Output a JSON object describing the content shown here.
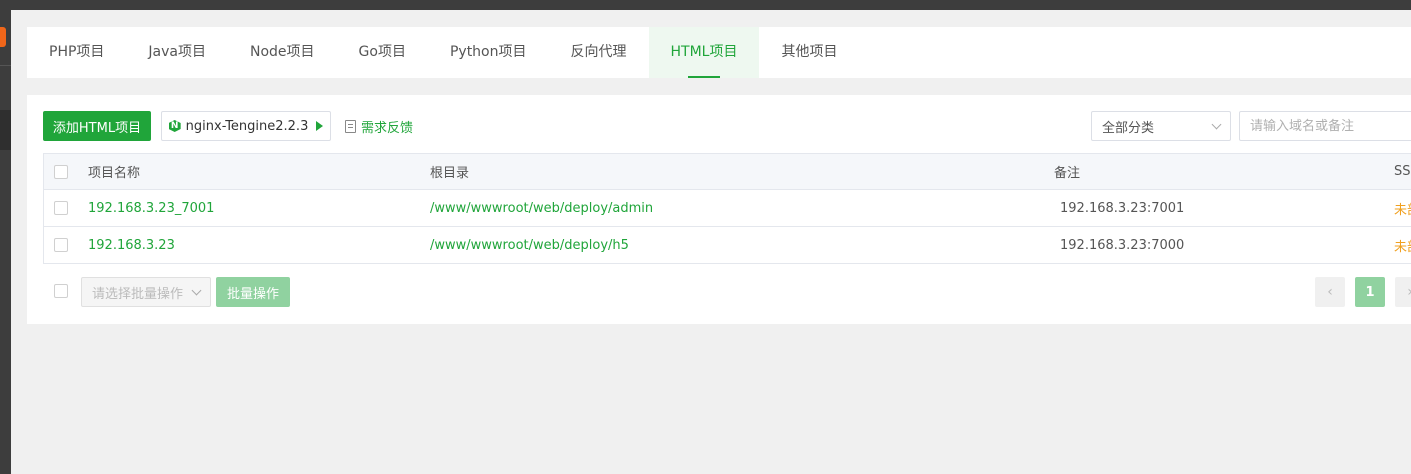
{
  "tabs": [
    {
      "label": "PHP项目"
    },
    {
      "label": "Java项目"
    },
    {
      "label": "Node项目"
    },
    {
      "label": "Go项目"
    },
    {
      "label": "Python项目"
    },
    {
      "label": "反向代理"
    },
    {
      "label": "HTML项目",
      "active": true
    },
    {
      "label": "其他项目"
    }
  ],
  "toolbar": {
    "add_label": "添加HTML项目",
    "nginx_label": "nginx-Tengine2.2.3",
    "nginx_icon": "N",
    "feedback_label": "需求反馈",
    "category_value": "全部分类",
    "search_placeholder": "请输入域名或备注"
  },
  "table": {
    "headers": {
      "name": "项目名称",
      "root": "根目录",
      "note": "备注",
      "ssl": "SSL"
    },
    "rows": [
      {
        "name": "192.168.3.23_7001",
        "root": "/www/wwwroot/web/deploy/admin",
        "note": "192.168.3.23:7001",
        "ssl": "未部署"
      },
      {
        "name": "192.168.3.23",
        "root": "/www/wwwroot/web/deploy/h5",
        "note": "192.168.3.23:7000",
        "ssl": "未部署"
      }
    ]
  },
  "footer": {
    "batch_placeholder": "请选择批量操作",
    "batch_button": "批量操作",
    "prev": "‹",
    "current_page": "1",
    "next": "›"
  },
  "colors": {
    "accent": "#20a53a",
    "warning": "#f0a020",
    "disabled_accent": "#90d2a0"
  }
}
